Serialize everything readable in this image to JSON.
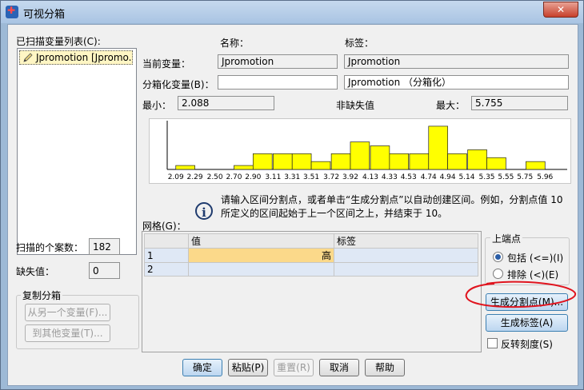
{
  "window": {
    "title": "可视分箱",
    "close_glyph": "✕"
  },
  "left": {
    "scanned_list_label": "已扫描变量列表(C):",
    "variables": [
      "Jpromotion [Jpromo..."
    ],
    "cases_label": "扫描的个案数：",
    "cases_value": "182",
    "missing_label": "缺失值：",
    "missing_value": "0",
    "copy_group_title": "复制分箱",
    "copy_from_button": "从另一个变量(F)...",
    "copy_to_button": "到其他变量(T)..."
  },
  "header": {
    "name_col": "名称：",
    "label_col": "标签："
  },
  "current": {
    "label": "当前变量：",
    "name": "Jpromotion",
    "var_label": "Jpromotion"
  },
  "binned": {
    "label": "分箱化变量(B)：",
    "name": "",
    "var_label": "Jpromotion （分箱化）"
  },
  "stats": {
    "min_label": "最小：",
    "min_value": "2.088",
    "nonmissing_label": "非缺失值",
    "max_label": "最大：",
    "max_value": "5.755"
  },
  "chart_data": {
    "type": "bar",
    "title": "",
    "xlabel": "",
    "ylabel": "",
    "tick_labels": [
      "2.09",
      "2.29",
      "2.50",
      "2.70",
      "2.90",
      "3.11",
      "3.31",
      "3.51",
      "3.72",
      "3.92",
      "4.13",
      "4.33",
      "4.53",
      "4.74",
      "4.94",
      "5.14",
      "5.35",
      "5.55",
      "5.75",
      "5.96"
    ],
    "x_range": [
      2.0,
      6.05
    ],
    "bin_width": 0.2,
    "bins": [
      {
        "x": 2.19,
        "count": 1
      },
      {
        "x": 2.8,
        "count": 1
      },
      {
        "x": 3.0,
        "count": 4
      },
      {
        "x": 3.21,
        "count": 4
      },
      {
        "x": 3.41,
        "count": 4
      },
      {
        "x": 3.61,
        "count": 2
      },
      {
        "x": 3.82,
        "count": 4
      },
      {
        "x": 4.02,
        "count": 7
      },
      {
        "x": 4.23,
        "count": 6
      },
      {
        "x": 4.43,
        "count": 4
      },
      {
        "x": 4.64,
        "count": 4
      },
      {
        "x": 4.84,
        "count": 11
      },
      {
        "x": 5.04,
        "count": 4
      },
      {
        "x": 5.25,
        "count": 5
      },
      {
        "x": 5.45,
        "count": 3
      },
      {
        "x": 5.86,
        "count": 2
      }
    ],
    "ylim": [
      0,
      12
    ],
    "bar_color": "#ffff00"
  },
  "info": {
    "text": "请输入区间分割点，或者单击“生成分割点”以自动创建区间。例如，分割点值 10 所定义的区间起始于上一个区间之上，并结束于 10。"
  },
  "grid": {
    "label": "网格(G)：",
    "columns": [
      "值",
      "标签"
    ],
    "rows": [
      {
        "num": "1",
        "value": "高",
        "label": ""
      },
      {
        "num": "2",
        "value": "",
        "label": ""
      }
    ]
  },
  "upper_endpoint": {
    "title": "上端点",
    "include_option": "包括 (<=)(I)",
    "exclude_option": "排除 (<)(E)"
  },
  "actions": {
    "make_cutpoints": "生成分割点(M)...",
    "make_labels": "生成标签(A)",
    "reverse_scale": "反转刻度(S)"
  },
  "footer": {
    "ok": "确定",
    "paste": "粘贴(P)",
    "reset": "重置(R)",
    "cancel": "取消",
    "help": "帮助"
  },
  "annotation_color": "#e0141e"
}
